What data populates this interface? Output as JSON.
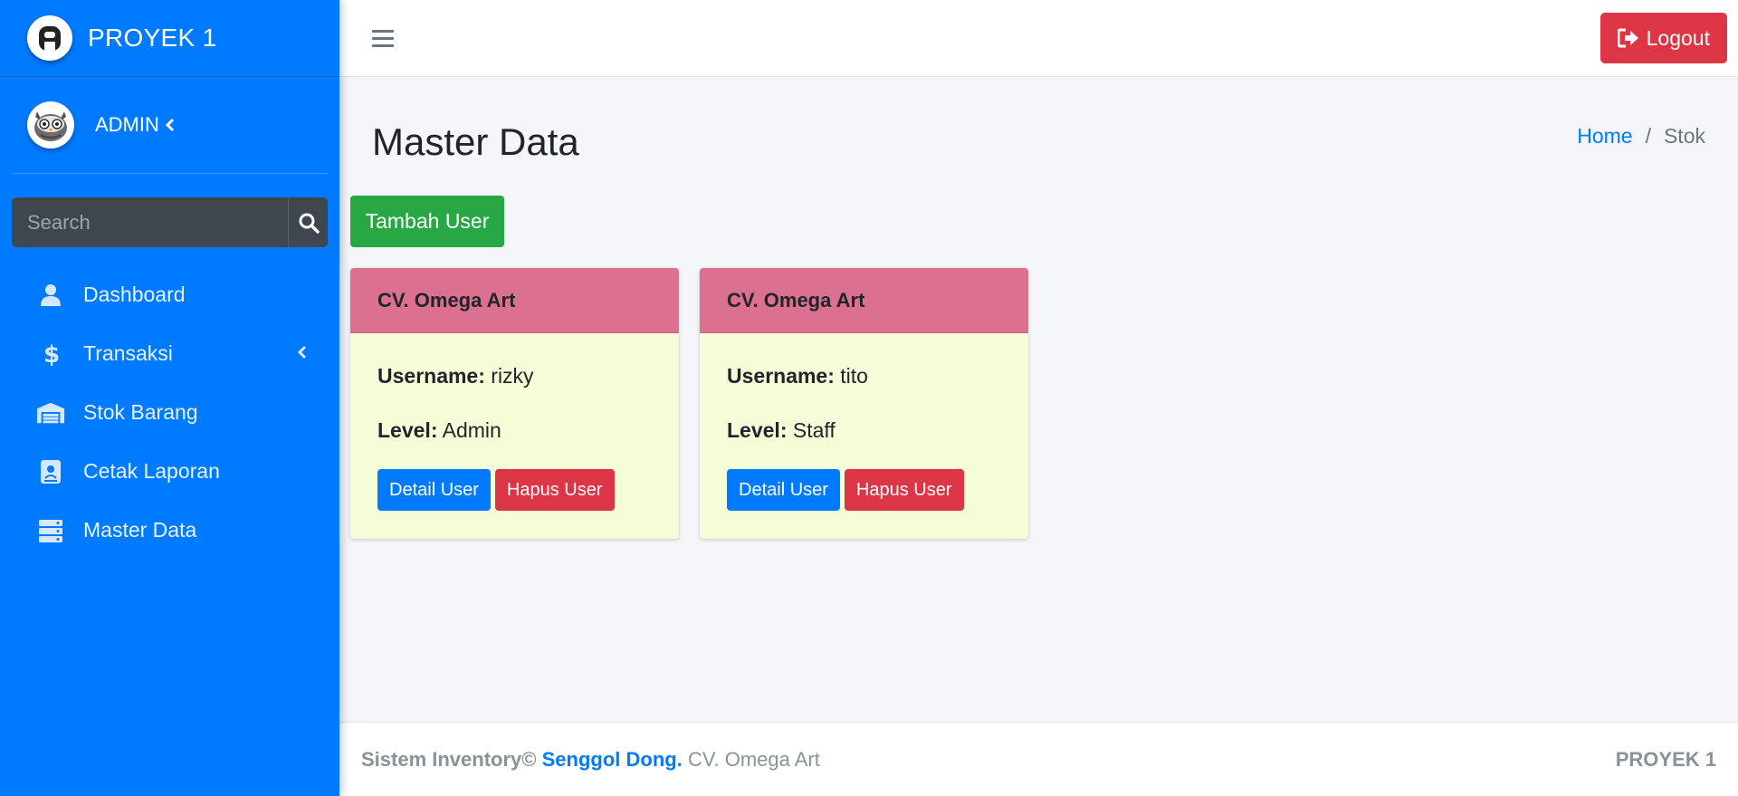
{
  "brand": {
    "name": "PROYEK 1",
    "logo_icon": "brand-logo-icon"
  },
  "user": {
    "name": "ADMIN",
    "avatar_icon": "owl-avatar"
  },
  "search": {
    "placeholder": "Search",
    "icon": "search-icon"
  },
  "sidebar": {
    "items": [
      {
        "label": "Dashboard",
        "icon": "user-icon"
      },
      {
        "label": "Transaksi",
        "icon": "dollar-icon",
        "has_submenu": true
      },
      {
        "label": "Stok Barang",
        "icon": "warehouse-icon"
      },
      {
        "label": "Cetak Laporan",
        "icon": "report-icon"
      },
      {
        "label": "Master Data",
        "icon": "server-icon"
      }
    ]
  },
  "navbar": {
    "logout_label": "Logout"
  },
  "header": {
    "title": "Master Data",
    "breadcrumb": {
      "home": "Home",
      "separator": "/",
      "current": "Stok"
    }
  },
  "actions": {
    "add_user_label": "Tambah User"
  },
  "cards": [
    {
      "title": "CV. Omega Art",
      "username_label": "Username:",
      "username": "rizky",
      "level_label": "Level:",
      "level": "Admin",
      "detail_label": "Detail User",
      "delete_label": "Hapus User"
    },
    {
      "title": "CV. Omega Art",
      "username_label": "Username:",
      "username": "tito",
      "level_label": "Level:",
      "level": "Staff",
      "detail_label": "Detail User",
      "delete_label": "Hapus User"
    }
  ],
  "footer": {
    "prefix": "Sistem Inventory©",
    "link": "Senggol Dong.",
    "company": "CV. Omega Art",
    "right": "PROYEK 1"
  },
  "colors": {
    "sidebar": "#007bff",
    "logout": "#dc3545",
    "add": "#28a745",
    "card_header": "#dc7090",
    "card_body": "#f5fdd8"
  }
}
